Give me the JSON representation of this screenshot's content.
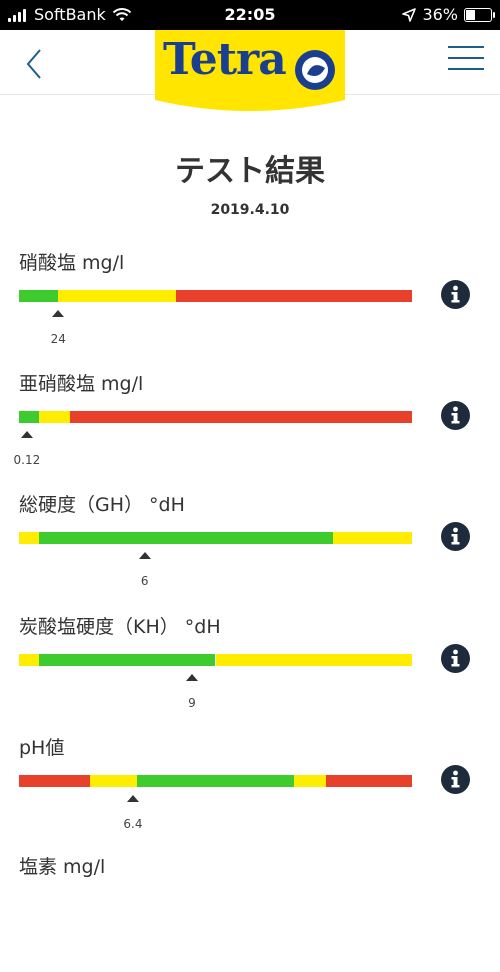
{
  "status_bar": {
    "carrier": "SoftBank",
    "time": "22:05",
    "battery": "36%"
  },
  "header": {
    "logo_text": "Tetra"
  },
  "page": {
    "title": "テスト結果",
    "date": "2019.4.10"
  },
  "colors": {
    "green": "#3ecb2e",
    "yellow": "#ffed00",
    "red": "#e8402a",
    "brand_blue": "#1b3f8f",
    "brand_yellow": "#ffe500"
  },
  "tests": [
    {
      "label": "硝酸塩 mg/l",
      "value_label": "24",
      "marker_fraction": 0.1,
      "segments": [
        {
          "color": "green",
          "from": 0,
          "to": 0.1
        },
        {
          "color": "yellow",
          "from": 0.1,
          "to": 0.4
        },
        {
          "color": "red",
          "from": 0.4,
          "to": 1
        }
      ]
    },
    {
      "label": "亜硝酸塩 mg/l",
      "value_label": "0.12",
      "marker_fraction": 0.02,
      "segments": [
        {
          "color": "green",
          "from": 0,
          "to": 0.05
        },
        {
          "color": "yellow",
          "from": 0.05,
          "to": 0.13
        },
        {
          "color": "red",
          "from": 0.13,
          "to": 1
        }
      ]
    },
    {
      "label": "総硬度（GH） °dH",
      "value_label": "6",
      "marker_fraction": 0.32,
      "segments": [
        {
          "color": "yellow",
          "from": 0,
          "to": 0.05
        },
        {
          "color": "green",
          "from": 0.05,
          "to": 0.8
        },
        {
          "color": "yellow",
          "from": 0.8,
          "to": 1
        }
      ]
    },
    {
      "label": "炭酸塩硬度（KH） °dH",
      "value_label": "9",
      "marker_fraction": 0.44,
      "segments": [
        {
          "color": "yellow",
          "from": 0,
          "to": 0.05
        },
        {
          "color": "green",
          "from": 0.05,
          "to": 0.5
        },
        {
          "color": "yellow",
          "from": 0.5,
          "to": 1
        }
      ]
    },
    {
      "label": "pH値",
      "value_label": "6.4",
      "marker_fraction": 0.29,
      "segments": [
        {
          "color": "red",
          "from": 0,
          "to": 0.18
        },
        {
          "color": "yellow",
          "from": 0.18,
          "to": 0.3
        },
        {
          "color": "green",
          "from": 0.3,
          "to": 0.7
        },
        {
          "color": "yellow",
          "from": 0.7,
          "to": 0.78
        },
        {
          "color": "red",
          "from": 0.78,
          "to": 1
        }
      ]
    },
    {
      "label": "塩素 mg/l"
    }
  ]
}
